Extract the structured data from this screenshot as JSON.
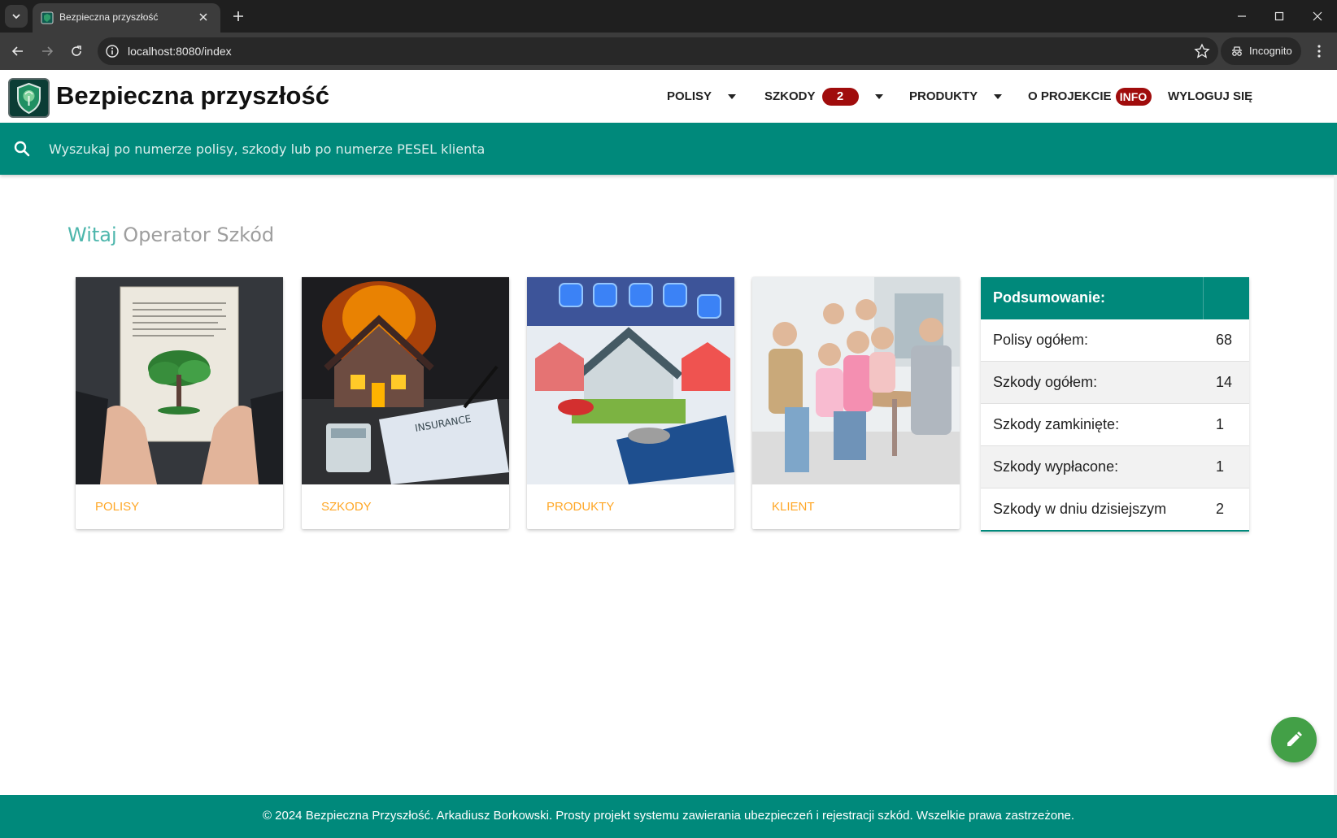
{
  "browser": {
    "tab_title": "Bezpieczna przyszłość",
    "url": "localhost:8080/index",
    "incognito_label": "Incognito"
  },
  "header": {
    "brand": "Bezpieczna przyszłość",
    "nav": {
      "polisy": "POLISY",
      "szkody": "SZKODY",
      "szkody_badge": "2",
      "produkty": "PRODUKTY",
      "o_projekcie": "O PROJEKCIE",
      "info_badge": "INFO",
      "wyloguj": "WYLOGUJ SIĘ"
    }
  },
  "search": {
    "placeholder": "Wyszukaj po numerze polisy, szkody lub po numerze PESEL klienta"
  },
  "welcome": {
    "greeting": "Witaj",
    "role": "Operator Szkód"
  },
  "cards": {
    "polisy": "POLISY",
    "szkody": "SZKODY",
    "produkty": "PRODUKTY",
    "klient": "KLIENT"
  },
  "summary": {
    "title": "Podsumowanie:",
    "rows": [
      {
        "label": "Polisy ogółem:",
        "value": "68"
      },
      {
        "label": "Szkody ogółem:",
        "value": "14"
      },
      {
        "label": "Szkody zamkinięte:",
        "value": "1"
      },
      {
        "label": "Szkody wypłacone:",
        "value": "1"
      },
      {
        "label": "Szkody w dniu dzisiejszym",
        "value": "2"
      }
    ]
  },
  "footer": {
    "text": "© 2024 Bezpieczna Przyszłość. Arkadiusz Borkowski. Prosty projekt systemu zawierania ubezpieczeń i rejestracji szkód. Wszelkie prawa zastrzeżone."
  },
  "colors": {
    "primary": "#00897b",
    "accent": "#ffa726",
    "badge": "#a00c0c",
    "fab": "#43a047",
    "welcome_highlight": "#4db6ac"
  },
  "icons": {
    "search": "search-icon",
    "fab": "pencil-icon",
    "logo": "shield-tree-logo-icon"
  }
}
